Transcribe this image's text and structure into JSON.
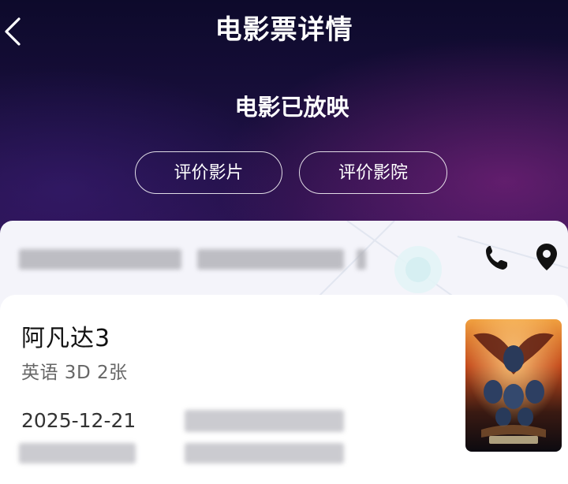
{
  "header": {
    "title": "电影票详情",
    "status": "电影已放映",
    "back_icon": "chevron-left-icon",
    "buttons": {
      "rate_movie": "评价影片",
      "rate_cinema": "评价影院"
    }
  },
  "cinema": {
    "phone_icon": "phone-icon",
    "location_icon": "location-pin-icon"
  },
  "ticket": {
    "movie_name": "阿凡达3",
    "meta": "英语 3D 2张",
    "date": "2025-12-21"
  },
  "colors": {
    "header_dark": "#0d0a2b",
    "header_purple": "#2a1250",
    "accent_magenta": "#962890",
    "card_bg": "#ffffff"
  }
}
